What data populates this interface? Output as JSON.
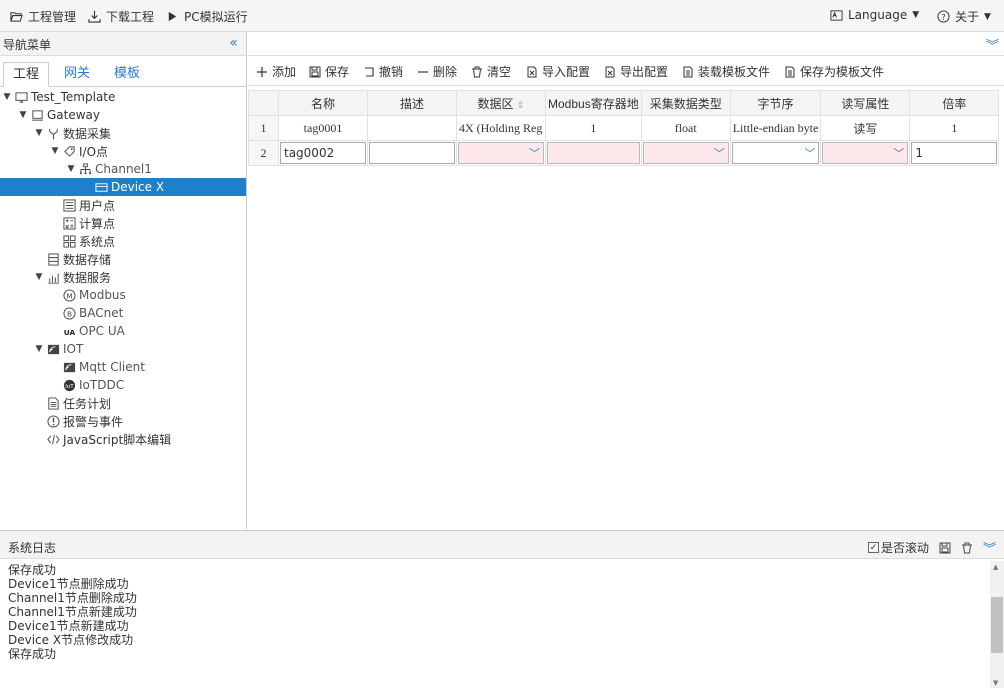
{
  "topbar": {
    "project_manage": "工程管理",
    "download_project": "下载工程",
    "pc_simulate": "PC模拟运行",
    "language": "Language",
    "about": "关于"
  },
  "nav": {
    "title": "导航菜单",
    "collapse": "«",
    "tabs": [
      "工程",
      "网关",
      "模板"
    ],
    "tree": [
      {
        "label": "Test_Template"
      },
      {
        "label": "Gateway"
      },
      {
        "label": "数据采集"
      },
      {
        "label": "I/O点"
      },
      {
        "label": "Channel1"
      },
      {
        "label": "Device X"
      },
      {
        "label": "用户点"
      },
      {
        "label": "计算点"
      },
      {
        "label": "系统点"
      },
      {
        "label": "数据存储"
      },
      {
        "label": "数据服务"
      },
      {
        "label": "Modbus"
      },
      {
        "label": "BACnet"
      },
      {
        "label": "OPC UA"
      },
      {
        "label": "IOT"
      },
      {
        "label": "Mqtt Client"
      },
      {
        "label": "IoTDDC"
      },
      {
        "label": "任务计划"
      },
      {
        "label": "报警与事件"
      },
      {
        "label": "JavaScript脚本编辑"
      }
    ]
  },
  "toolbar": {
    "add": "添加",
    "save": "保存",
    "undo": "撤销",
    "delete": "删除",
    "clear": "清空",
    "import": "导入配置",
    "export": "导出配置",
    "load_template": "装载模板文件",
    "save_template": "保存为模板文件"
  },
  "table": {
    "headers": [
      "名称",
      "描述",
      "数据区",
      "Modbus寄存器地",
      "采集数据类型",
      "字节序",
      "读写属性",
      "倍率"
    ],
    "rows": [
      {
        "num": "1",
        "name": "tag0001",
        "desc": "",
        "area": "4X (Holding Reg",
        "addr": "1",
        "type": "float",
        "order": "Little-endian byte",
        "rw": "读写",
        "scale": "1"
      },
      {
        "num": "2",
        "name": "tag0002",
        "desc": "",
        "area": "",
        "addr": "",
        "type": "",
        "order": "",
        "rw": "",
        "scale": "1"
      }
    ]
  },
  "log": {
    "title": "系统日志",
    "autoscroll": "是否滚动",
    "lines": [
      "保存成功",
      "Device1节点删除成功",
      "Channel1节点删除成功",
      "Channel1节点新建成功",
      "Device1节点新建成功",
      "Device X节点修改成功",
      "保存成功"
    ]
  }
}
